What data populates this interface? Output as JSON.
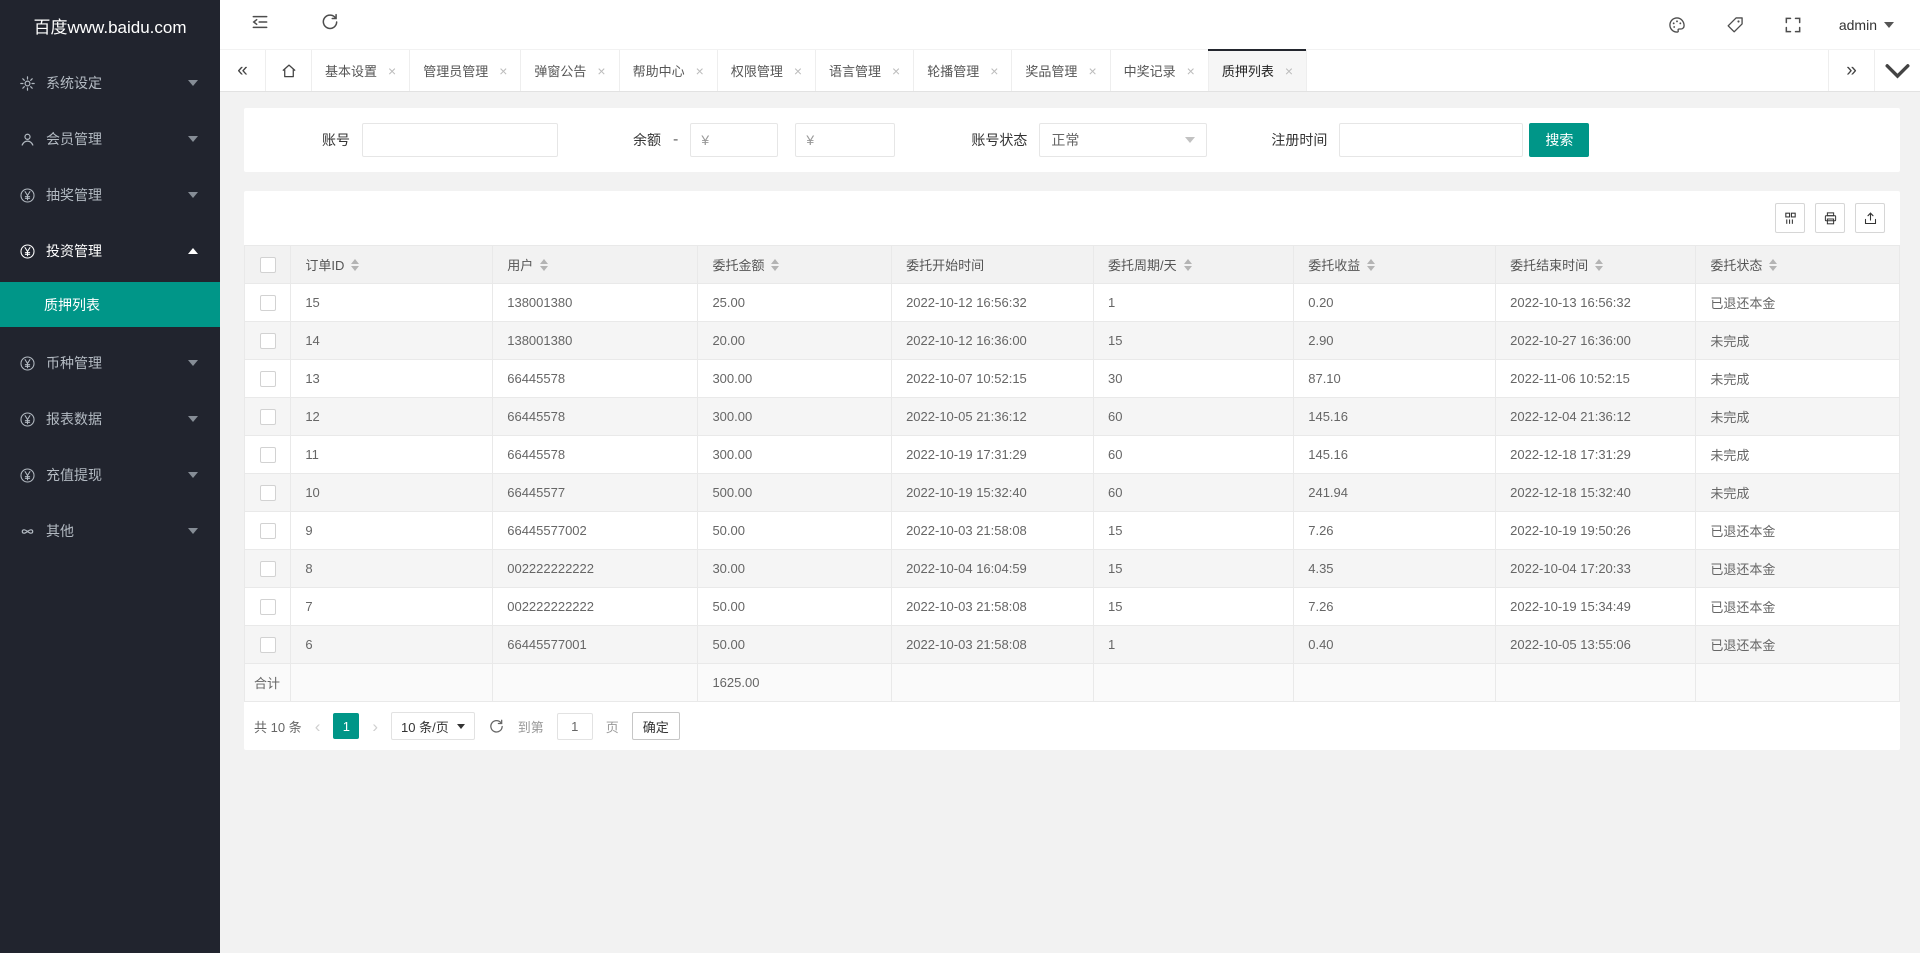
{
  "colors": {
    "accent": "#009688",
    "sidebar_bg": "#21242e",
    "tab_active_bar": "#23262e"
  },
  "app": {
    "logo": "百度www.baidu.com"
  },
  "sidebar": {
    "items": [
      {
        "key": "system-settings",
        "icon": "gear-icon",
        "label": "系统设定",
        "expanded": false
      },
      {
        "key": "member-management",
        "icon": "user-icon",
        "label": "会员管理",
        "expanded": false
      },
      {
        "key": "lottery-management",
        "icon": "yen-icon",
        "label": "抽奖管理",
        "expanded": false
      },
      {
        "key": "invest-management",
        "icon": "yen-icon",
        "label": "投资管理",
        "expanded": true,
        "children": [
          {
            "key": "pledge-list",
            "label": "质押列表",
            "active": true
          }
        ]
      },
      {
        "key": "currency-management",
        "icon": "yen-icon",
        "label": "币种管理",
        "expanded": false
      },
      {
        "key": "report-data",
        "icon": "yen-icon",
        "label": "报表数据",
        "expanded": false
      },
      {
        "key": "recharge-withdraw",
        "icon": "yen-icon",
        "label": "充值提现",
        "expanded": false
      },
      {
        "key": "other",
        "icon": "infinity-icon",
        "label": "其他",
        "expanded": false
      }
    ]
  },
  "topbar": {
    "user": "admin"
  },
  "tabs": {
    "items": [
      {
        "key": "basic-settings",
        "label": "基本设置"
      },
      {
        "key": "admin-management",
        "label": "管理员管理"
      },
      {
        "key": "popup-notice",
        "label": "弹窗公告"
      },
      {
        "key": "help-center",
        "label": "帮助中心"
      },
      {
        "key": "permission",
        "label": "权限管理"
      },
      {
        "key": "language",
        "label": "语言管理"
      },
      {
        "key": "carousel",
        "label": "轮播管理"
      },
      {
        "key": "prize-management",
        "label": "奖品管理"
      },
      {
        "key": "winning-records",
        "label": "中奖记录"
      },
      {
        "key": "pledge-list",
        "label": "质押列表",
        "active": true
      }
    ]
  },
  "filter": {
    "account_label": "账号",
    "balance_label": "余额",
    "balance_separator": "-",
    "balance_placeholder": "¥",
    "status_label": "账号状态",
    "status_value": "正常",
    "regtime_label": "注册时间",
    "search_label": "搜索"
  },
  "table": {
    "columns": [
      {
        "label": "订单ID",
        "sortable": true
      },
      {
        "label": "用户",
        "sortable": true
      },
      {
        "label": "委托金额",
        "sortable": true
      },
      {
        "label": "委托开始时间",
        "sortable": false
      },
      {
        "label": "委托周期/天",
        "sortable": true
      },
      {
        "label": "委托收益",
        "sortable": true
      },
      {
        "label": "委托结束时间",
        "sortable": true
      },
      {
        "label": "委托状态",
        "sortable": true
      }
    ],
    "rows": [
      [
        "15",
        "138001380",
        "25.00",
        "2022-10-12 16:56:32",
        "1",
        "0.20",
        "2022-10-13 16:56:32",
        "已退还本金"
      ],
      [
        "14",
        "138001380",
        "20.00",
        "2022-10-12 16:36:00",
        "15",
        "2.90",
        "2022-10-27 16:36:00",
        "未完成"
      ],
      [
        "13",
        "66445578",
        "300.00",
        "2022-10-07 10:52:15",
        "30",
        "87.10",
        "2022-11-06 10:52:15",
        "未完成"
      ],
      [
        "12",
        "66445578",
        "300.00",
        "2022-10-05 21:36:12",
        "60",
        "145.16",
        "2022-12-04 21:36:12",
        "未完成"
      ],
      [
        "11",
        "66445578",
        "300.00",
        "2022-10-19 17:31:29",
        "60",
        "145.16",
        "2022-12-18 17:31:29",
        "未完成"
      ],
      [
        "10",
        "66445577",
        "500.00",
        "2022-10-19 15:32:40",
        "60",
        "241.94",
        "2022-12-18 15:32:40",
        "未完成"
      ],
      [
        "9",
        "66445577002",
        "50.00",
        "2022-10-03 21:58:08",
        "15",
        "7.26",
        "2022-10-19 19:50:26",
        "已退还本金"
      ],
      [
        "8",
        "002222222222",
        "30.00",
        "2022-10-04 16:04:59",
        "15",
        "4.35",
        "2022-10-04 17:20:33",
        "已退还本金"
      ],
      [
        "7",
        "002222222222",
        "50.00",
        "2022-10-03 21:58:08",
        "15",
        "7.26",
        "2022-10-19 15:34:49",
        "已退还本金"
      ],
      [
        "6",
        "66445577001",
        "50.00",
        "2022-10-03 21:58:08",
        "1",
        "0.40",
        "2022-10-05 13:55:06",
        "已退还本金"
      ]
    ],
    "summary": {
      "label": "合计",
      "total": "1625.00"
    }
  },
  "pagination": {
    "total_text": "共 10 条",
    "current_page": "1",
    "page_size": "10 条/页",
    "goto_label": "到第",
    "goto_value": "1",
    "page_unit": "页",
    "confirm_label": "确定"
  }
}
